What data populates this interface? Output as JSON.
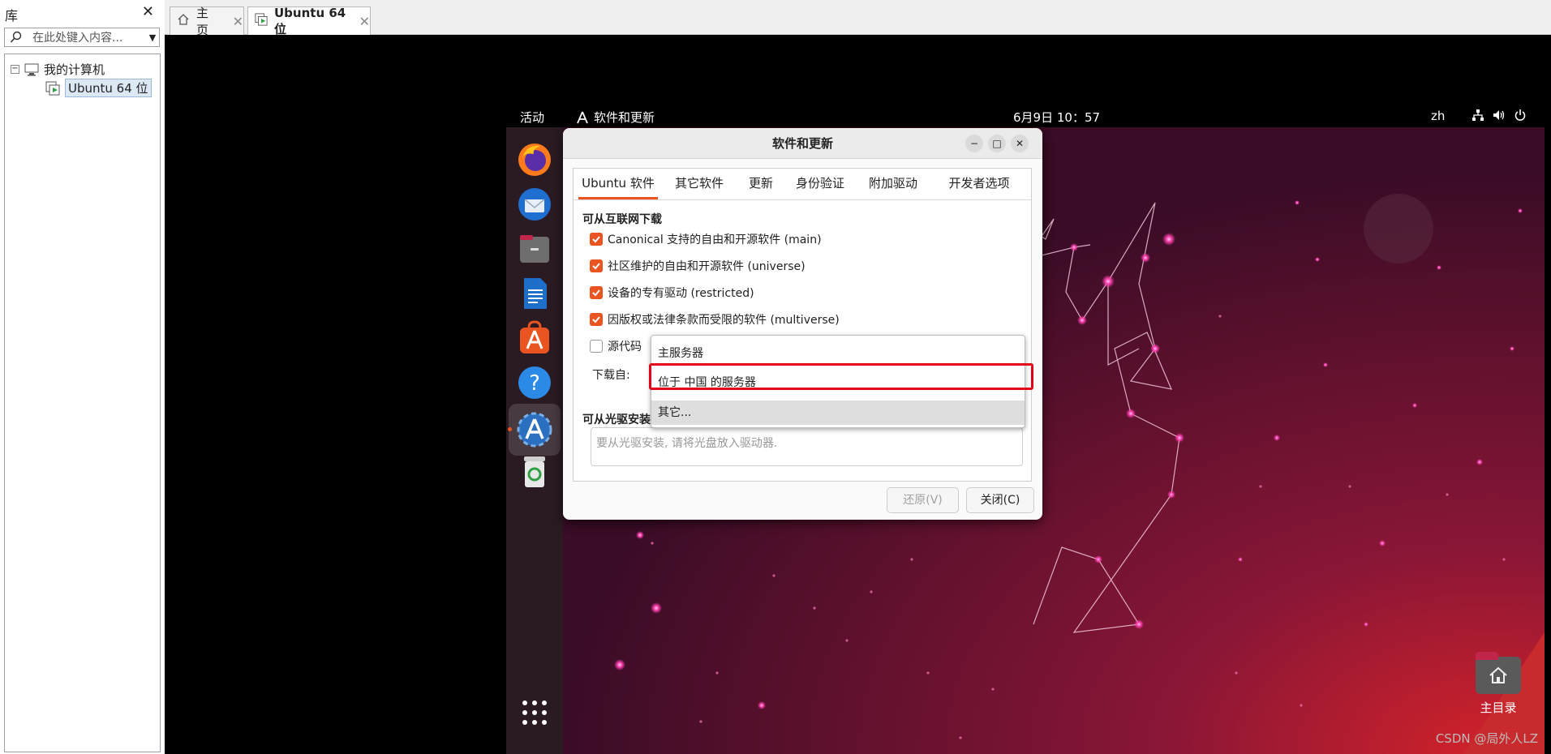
{
  "library": {
    "title": "库",
    "close_glyph": "✕",
    "search_placeholder": "在此处键入内容...",
    "tree": {
      "root_collapse": "−",
      "root_label": "我的计算机",
      "vm_label": "Ubuntu 64 位"
    }
  },
  "tabs": [
    {
      "label": "主页",
      "close": "✕"
    },
    {
      "label": "Ubuntu 64 位",
      "close": "✕"
    }
  ],
  "guest": {
    "topbar": {
      "activities": "活动",
      "app_menu": "软件和更新",
      "clock": "6月9日  10：57",
      "lang": "zh"
    },
    "desktop": {
      "home_label": "主目录"
    }
  },
  "dialog": {
    "title": "软件和更新",
    "window_buttons": {
      "minimize": "−",
      "maximize": "□",
      "close": "✕"
    },
    "tabs": [
      "Ubuntu 软件",
      "其它软件",
      "更新",
      "身份验证",
      "附加驱动",
      "开发者选项"
    ],
    "internet_section": "可从互联网下载",
    "checks": [
      {
        "label": "Canonical 支持的自由和开源软件 (main)",
        "checked": true
      },
      {
        "label": "社区维护的自由和开源软件 (universe)",
        "checked": true
      },
      {
        "label": "设备的专有驱动 (restricted)",
        "checked": true
      },
      {
        "label": "因版权或法律条款而受限的软件 (multiverse)",
        "checked": true
      },
      {
        "label": "源代码",
        "checked": false
      }
    ],
    "download_from_label": "下载自:",
    "cdrom_section": "可从光驱安装",
    "cdrom_placeholder": "要从光驱安装, 请将光盘放入驱动器.",
    "dropdown_options": [
      "主服务器",
      "位于 中国 的服务器",
      "其它..."
    ],
    "dropdown_selected": "其它...",
    "buttons": {
      "revert": "还原(V)",
      "close": "关闭(C)"
    }
  },
  "watermark": "CSDN @局外人LZ",
  "colors": {
    "ubuntu_orange": "#e95420",
    "highlight_red": "#e5001a",
    "wallpaper_dark": "#2a0a1c",
    "wallpaper_accent": "#c1264a"
  }
}
